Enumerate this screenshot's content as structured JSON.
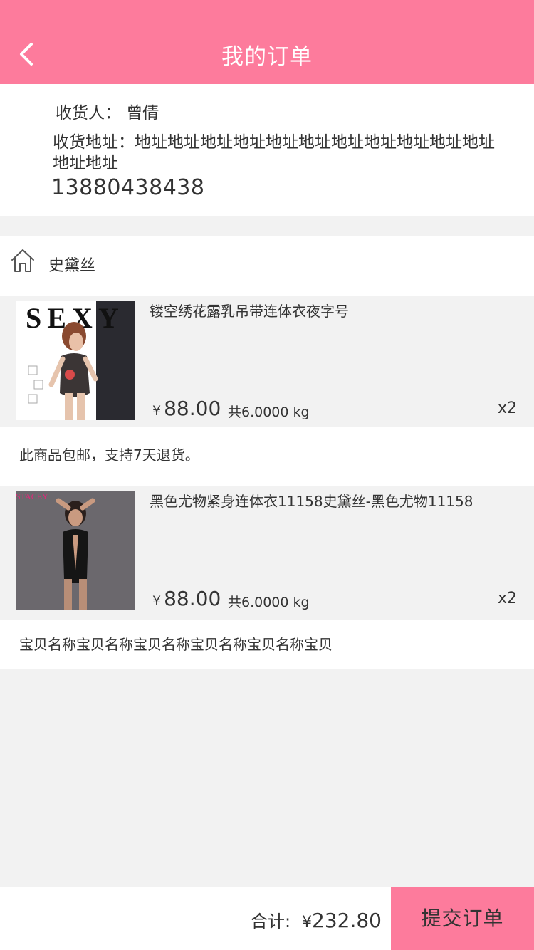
{
  "header": {
    "title": "我的订单",
    "back_icon": "chevron-left-icon",
    "color": "#fd7b9c"
  },
  "address": {
    "receiver": "收货人：  曾倩",
    "address": "收货地址：地址地址地址地址地址地址地址地址地址地址地址地址地址",
    "phone": "13880438438"
  },
  "shop": {
    "icon": "home-icon",
    "name": "史黛丝"
  },
  "products": [
    {
      "title": "镂空绣花露乳吊带连体衣夜字号",
      "currency": "¥",
      "price": "88.00",
      "weight": "共6.0000  kg",
      "qty": "x2",
      "thumb_text": "SEXY"
    },
    {
      "title": "黑色尤物紧身连体衣11158史黛丝-黑色尤物11158",
      "currency": "¥",
      "price": "88.00",
      "weight": "共6.0000  kg",
      "qty": "x2",
      "thumb_text": "STACEY"
    }
  ],
  "notes": [
    "此商品包邮，支持7天退货。",
    "宝贝名称宝贝名称宝贝名称宝贝名称宝贝名称宝贝"
  ],
  "footer": {
    "total_label": "合计:",
    "currency": "¥",
    "total_value": "232.80",
    "submit_label": "提交订单"
  }
}
